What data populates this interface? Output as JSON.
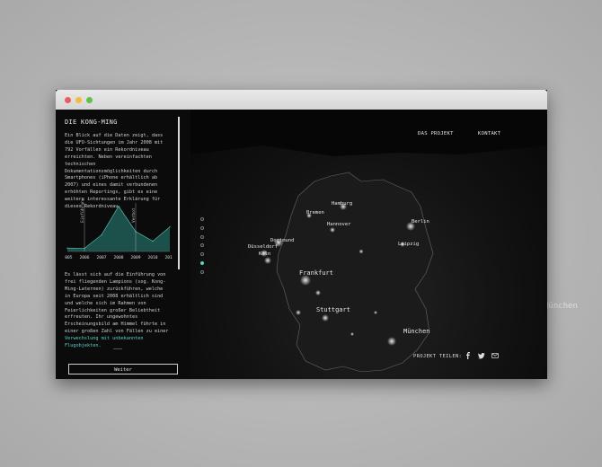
{
  "background_ghost_text": "München",
  "panel": {
    "title": "DIE KONG-MING",
    "paragraph1": "Ein Blick auf die Daten zeigt, dass die UFO-Sichtungen im Jahr 2008 mit 792 Vorfällen ein Rekordniveau erreichten. Neben vereinfachten technischen Dokumentationsmöglichkeiten durch Smartphones (iPhone erhältlich ab 2007) und eines damit verbundenen erhöhten Reportings, gibt es eine weitere interessante Erklärung für dieses Rekordniveau.",
    "paragraph2": "Es lässt sich auf die Einführung von frei fliegenden Lampions (sog. Kong-Ming-Laternen) zurückführen, welche in Europa seit 2008 erhältlich sind und welche sich im Rahmen von Feierlichkeiten großer Beliebtheit erfreuten. Ihr ungewohntes Erscheinungsbild am Himmel führte in einer großen Zahl von Fällen zu einer",
    "paragraph2_link": "Verwechslung mit unbekannten Flugobjekten.",
    "button_label": "Weiter"
  },
  "chart_data": {
    "type": "area",
    "categories": [
      "2005",
      "2006",
      "2007",
      "2008",
      "2009",
      "2010",
      "2011"
    ],
    "values": [
      60,
      55,
      290,
      792,
      350,
      180,
      430
    ],
    "ylim": [
      0,
      850
    ],
    "annotations": [
      {
        "label": "Einführung",
        "x": "2006"
      },
      {
        "label": "Verbot",
        "x": "2009"
      }
    ],
    "grid": false
  },
  "nav": {
    "projekt": "DAS PROJEKT",
    "kontakt": "KONTAKT"
  },
  "cities": {
    "hamburg": "Hamburg",
    "bremen": "Bremen",
    "hannover": "Hannover",
    "berlin": "Berlin",
    "dortmund": "Dortmund",
    "duesseldorf": "Düsseldorf",
    "koeln": "Köln",
    "leipzig": "Leipzig",
    "frankfurt": "Frankfurt",
    "stuttgart": "Stuttgart",
    "muenchen": "München"
  },
  "share": {
    "label": "PROJEKT TEILEN:",
    "icons": [
      "facebook-icon",
      "twitter-icon",
      "mail-icon"
    ]
  },
  "steps": {
    "count": 7,
    "active_index": 5
  },
  "colors": {
    "accent": "#58d2c4",
    "chart_fill": "#1f5e56",
    "map_bg": "#111111"
  }
}
